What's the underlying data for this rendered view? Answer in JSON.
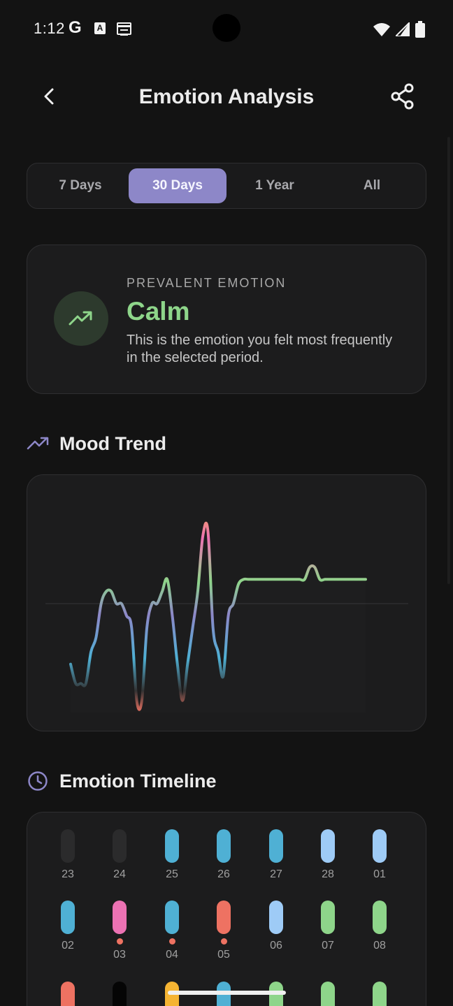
{
  "status": {
    "time": "1:12",
    "g_label": "G",
    "a_label": "A"
  },
  "header": {
    "title": "Emotion Analysis"
  },
  "range_tabs": [
    {
      "label": "7 Days",
      "active": false
    },
    {
      "label": "30 Days",
      "active": true
    },
    {
      "label": "1 Year",
      "active": false
    },
    {
      "label": "All",
      "active": false
    }
  ],
  "prevalent": {
    "label": "PREVALENT EMOTION",
    "emotion": "Calm",
    "description": "This is the emotion you felt most frequently in the selected period."
  },
  "mood_trend": {
    "title": "Mood Trend"
  },
  "timeline": {
    "title": "Emotion Timeline",
    "rows": [
      [
        {
          "day": "23",
          "color": "#2b2b2c",
          "dot": false
        },
        {
          "day": "24",
          "color": "#2b2b2c",
          "dot": false
        },
        {
          "day": "25",
          "color": "#4fb0d4",
          "dot": false
        },
        {
          "day": "26",
          "color": "#4fb0d4",
          "dot": false
        },
        {
          "day": "27",
          "color": "#4fb0d4",
          "dot": false
        },
        {
          "day": "28",
          "color": "#9ecbf6",
          "dot": false
        },
        {
          "day": "01",
          "color": "#9ecbf6",
          "dot": false
        }
      ],
      [
        {
          "day": "02",
          "color": "#4fb0d4",
          "dot": false
        },
        {
          "day": "03",
          "color": "#ec72b3",
          "dot": true
        },
        {
          "day": "04",
          "color": "#4fb0d4",
          "dot": true
        },
        {
          "day": "05",
          "color": "#ee7262",
          "dot": true
        },
        {
          "day": "06",
          "color": "#9ecbf6",
          "dot": false
        },
        {
          "day": "07",
          "color": "#8ed58a",
          "dot": false
        },
        {
          "day": "08",
          "color": "#8ed58a",
          "dot": false
        }
      ],
      [
        {
          "day": "",
          "color": "#ee7262",
          "dot": false
        },
        {
          "day": "",
          "color": "#050505",
          "dot": false
        },
        {
          "day": "",
          "color": "#f5b433",
          "dot": false
        },
        {
          "day": "",
          "color": "#4fb0d4",
          "dot": false
        },
        {
          "day": "",
          "color": "#8ed58a",
          "dot": false
        },
        {
          "day": "",
          "color": "#8ed58a",
          "dot": false
        },
        {
          "day": "",
          "color": "#8ed58a",
          "dot": false
        }
      ]
    ]
  },
  "chart_data": {
    "type": "line",
    "title": "",
    "xlabel": "",
    "ylabel": "",
    "x": [
      1,
      2,
      3,
      4,
      5,
      6,
      7,
      8,
      9,
      10,
      11,
      12,
      13,
      14,
      15,
      16,
      17,
      18,
      19,
      20,
      21,
      22,
      23,
      24,
      25,
      26,
      27,
      28,
      29,
      30,
      31,
      32,
      33,
      34,
      35,
      36,
      37,
      38,
      39,
      40,
      41,
      42,
      43,
      44,
      45,
      46,
      47,
      48,
      49,
      50,
      51,
      52,
      53,
      54,
      55,
      56,
      57,
      58,
      59
    ],
    "series": [
      {
        "values": [
          -0.25,
          -0.33,
          -0.33,
          -0.33,
          -0.2,
          -0.14,
          0.0,
          0.05,
          0.05,
          0.0,
          0.0,
          -0.05,
          -0.1,
          -0.4,
          -0.4,
          -0.1,
          0.0,
          0.0,
          0.05,
          0.1,
          -0.05,
          -0.25,
          -0.4,
          -0.25,
          -0.1,
          0.05,
          0.28,
          0.3,
          -0.1,
          -0.2,
          -0.3,
          -0.05,
          0.0,
          0.08,
          0.1,
          0.1,
          0.1,
          0.1,
          0.1,
          0.1,
          0.1,
          0.1,
          0.1,
          0.1,
          0.1,
          0.1,
          0.1,
          0.15,
          0.15,
          0.1,
          0.1,
          0.1,
          0.1,
          0.1,
          0.1,
          0.1,
          0.1,
          0.1,
          0.1
        ]
      }
    ],
    "ylim": [
      -0.45,
      0.45
    ],
    "grid": false,
    "legend": "none"
  }
}
